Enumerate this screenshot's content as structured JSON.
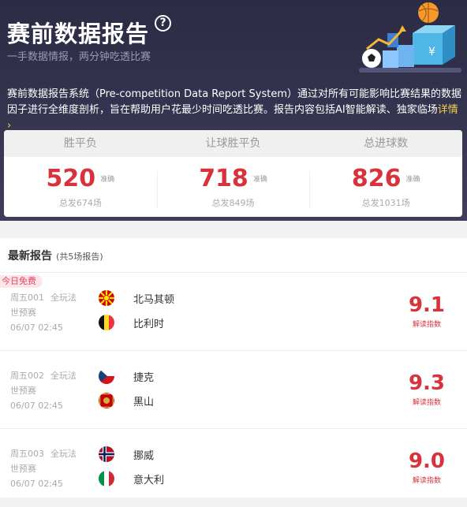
{
  "header": {
    "title": "赛前数据报告",
    "help_icon": "question-circle-icon",
    "subtitle": "一手数据情报，两分钟吃透比赛",
    "intro": "赛前数据报告系统（Pre-competition Data Report System）通过对所有可能影响比赛结果的数据因子进行全维度剖析，旨在帮助用户花最少时间吃透比赛。报告内容包括AI智能解读、独家临场",
    "more": "详情"
  },
  "stats": [
    {
      "label": "胜平负",
      "value": "520",
      "tag": "准确",
      "total": "总发674场"
    },
    {
      "label": "让球胜平负",
      "value": "718",
      "tag": "准确",
      "total": "总发849场"
    },
    {
      "label": "总进球数",
      "value": "826",
      "tag": "准确",
      "total": "总发1031场"
    }
  ],
  "reports": {
    "title": "最新报告",
    "count": "(共5场报告)",
    "free_badge": "今日免费",
    "items": [
      {
        "code": "周五001",
        "play": "全玩法",
        "league": "世预赛",
        "time": "06/07 02:45",
        "home": "北马其顿",
        "home_flag": "north-macedonia-flag-icon",
        "away": "比利时",
        "away_flag": "belgium-flag-icon",
        "score": "9.1",
        "score_label": "解读指数"
      },
      {
        "code": "周五002",
        "play": "全玩法",
        "league": "世预赛",
        "time": "06/07 02:45",
        "home": "捷克",
        "home_flag": "czech-flag-icon",
        "away": "黑山",
        "away_flag": "montenegro-flag-icon",
        "score": "9.3",
        "score_label": "解读指数"
      },
      {
        "code": "周五003",
        "play": "全玩法",
        "league": "世预赛",
        "time": "06/07 02:45",
        "home": "挪威",
        "home_flag": "norway-flag-icon",
        "away": "意大利",
        "away_flag": "italy-flag-icon",
        "score": "9.0",
        "score_label": "解读指数"
      }
    ]
  },
  "colors": {
    "accent_red": "#d8323c",
    "header_bg": "#2c2b45",
    "link_yellow": "#f5d24a",
    "badge_bg": "#fde6ea"
  }
}
